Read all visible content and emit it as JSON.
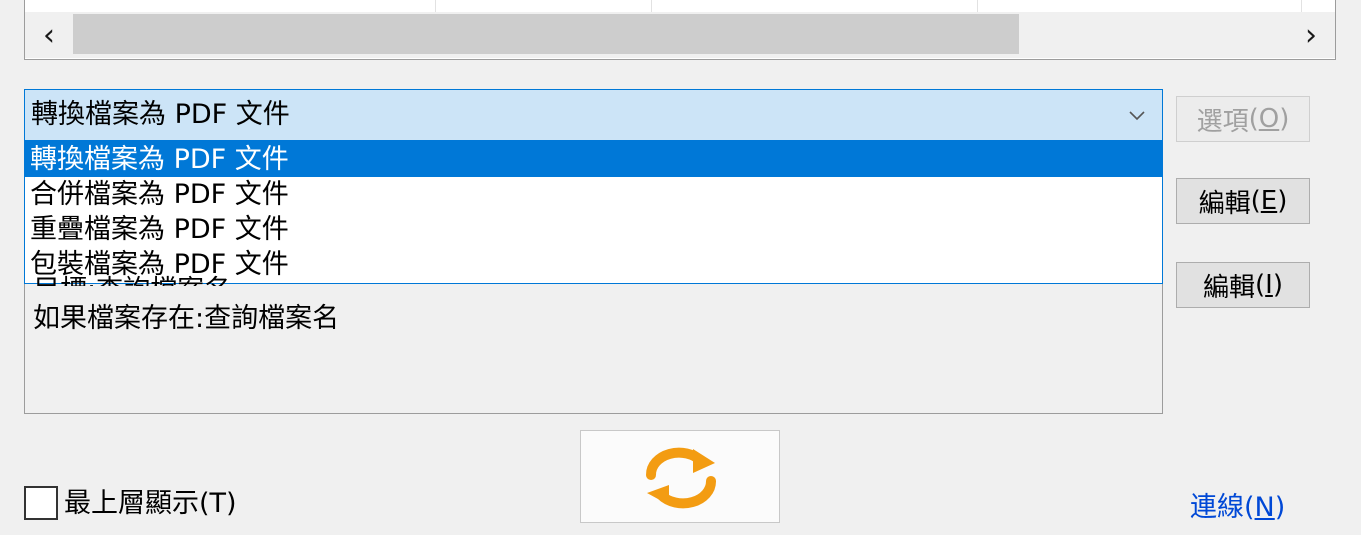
{
  "top_list": {
    "scroll_left": "‹",
    "scroll_right": "›"
  },
  "combo": {
    "selected": "轉換檔案為 PDF 文件",
    "options": [
      "轉換檔案為 PDF 文件",
      "合併檔案為 PDF 文件",
      "重疊檔案為 PDF 文件",
      "包裝檔案為 PDF 文件"
    ],
    "arrow_icon": "chevron-down-icon"
  },
  "details": {
    "line1": "目標:查詢檔案名",
    "line2": "如果檔案存在:查詢檔案名"
  },
  "buttons": {
    "options_text": "選項",
    "options_key": "O",
    "edit_e_text": "編輯",
    "edit_e_key": "E",
    "edit_i_text": "編輯",
    "edit_i_key": "I"
  },
  "refresh_icon": "refresh-icon",
  "refresh_color": "#f39c12",
  "topmost": {
    "label": "最上層顯示(T)",
    "checked": false
  },
  "connect": {
    "text": "連線",
    "key": "N"
  },
  "colors": {
    "accent": "#0078d7",
    "combo_bg": "#cce4f7",
    "link": "#0048d6",
    "disabled": "#a0a0a0"
  }
}
